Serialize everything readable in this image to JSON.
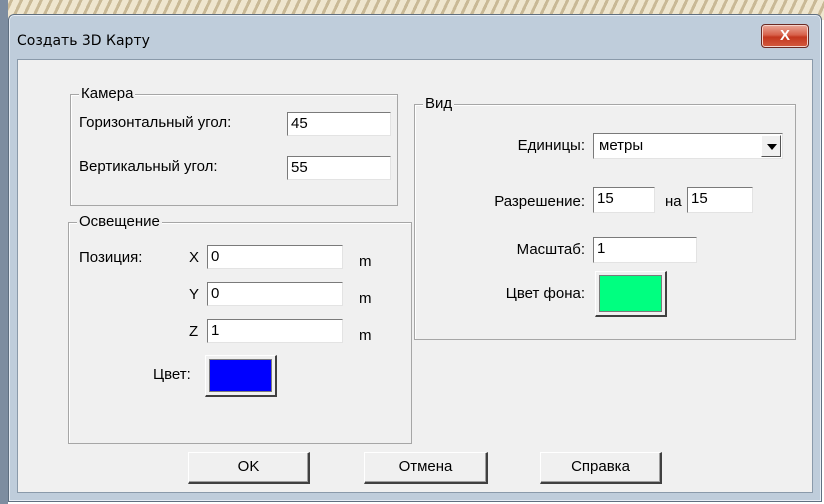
{
  "window": {
    "title": "Создать 3D Карту",
    "close_label": "X"
  },
  "camera": {
    "title": "Камера",
    "h_angle_label": "Горизонтальный угол:",
    "h_angle_value": "45",
    "v_angle_label": "Вертикальный угол:",
    "v_angle_value": "55"
  },
  "lighting": {
    "title": "Освещение",
    "position_label": "Позиция:",
    "x_label": "X",
    "x_value": "0",
    "y_label": "Y",
    "y_value": "0",
    "z_label": "Z",
    "z_value": "1",
    "unit": "m",
    "color_label": "Цвет:",
    "color": "#0000ff"
  },
  "view": {
    "title": "Вид",
    "units_label": "Единицы:",
    "units_value": "метры",
    "resolution_label": "Разрешение:",
    "res_w": "15",
    "res_sep": "на",
    "res_h": "15",
    "scale_label": "Масштаб:",
    "scale_value": "1",
    "bg_color_label": "Цвет фона:",
    "bg_color": "#00ff80"
  },
  "buttons": {
    "ok": "ОK",
    "cancel": "Отмена",
    "help": "Справка"
  }
}
